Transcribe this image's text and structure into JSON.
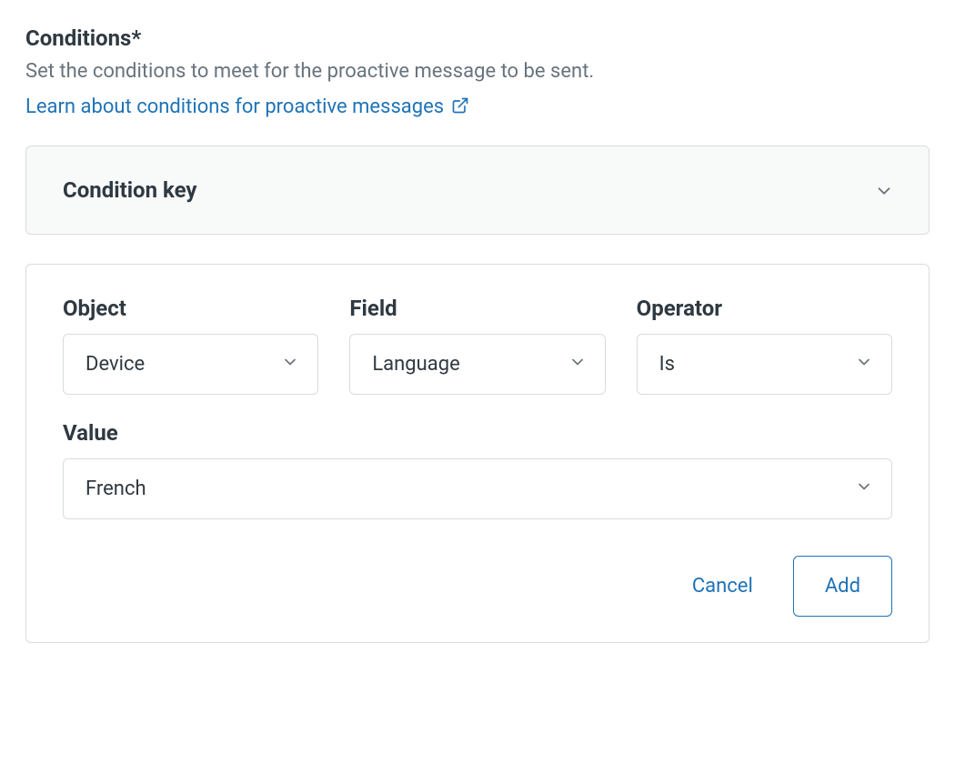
{
  "section": {
    "title": "Conditions*",
    "subtitle": "Set the conditions to meet for the proactive message to be sent.",
    "link_text": "Learn about conditions for proactive messages"
  },
  "condition_key": {
    "title": "Condition key"
  },
  "form": {
    "object": {
      "label": "Object",
      "value": "Device"
    },
    "field": {
      "label": "Field",
      "value": "Language"
    },
    "operator": {
      "label": "Operator",
      "value": "Is"
    },
    "value": {
      "label": "Value",
      "value": "French"
    },
    "actions": {
      "cancel": "Cancel",
      "add": "Add"
    }
  }
}
